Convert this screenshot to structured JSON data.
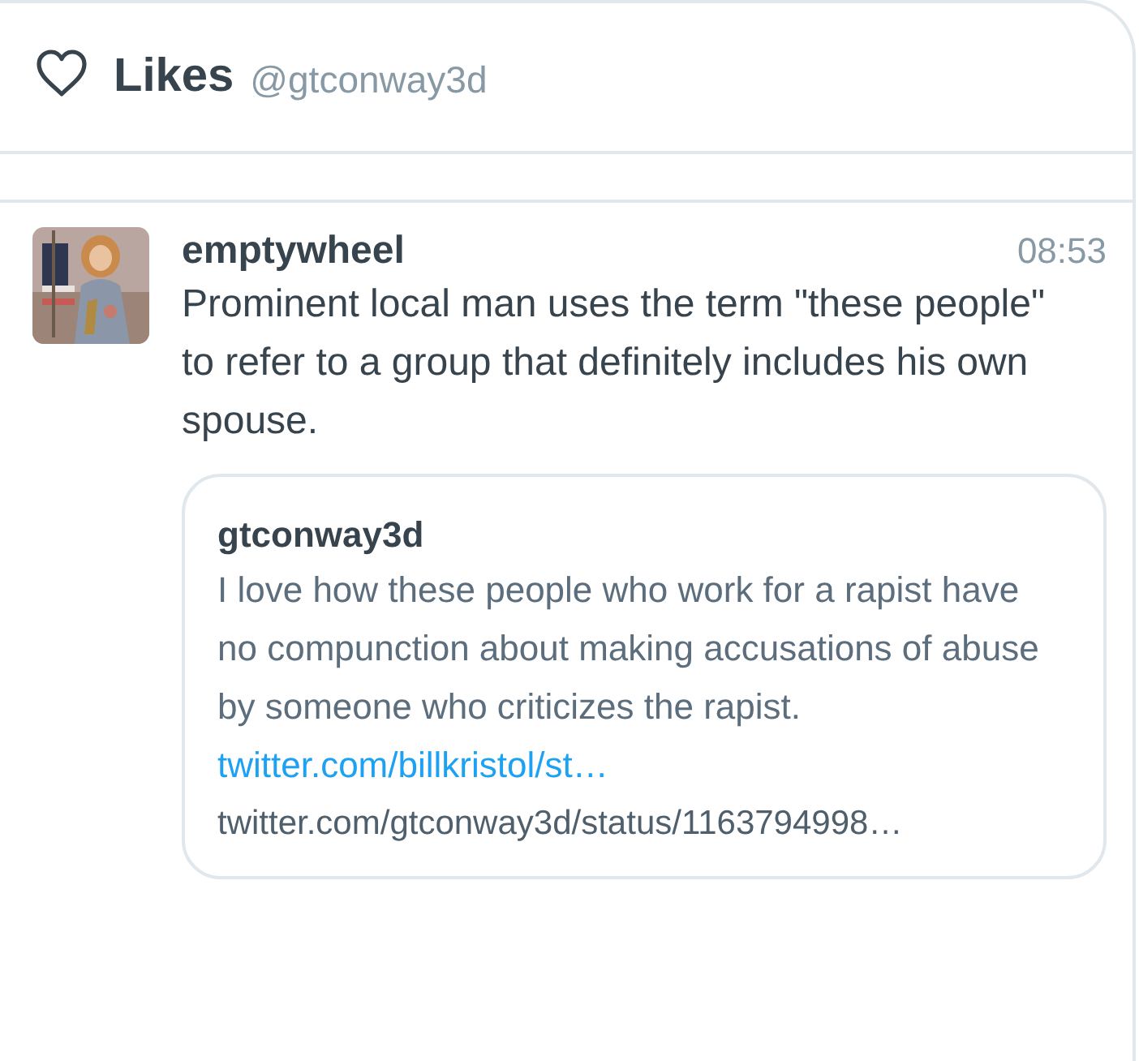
{
  "header": {
    "title": "Likes",
    "handle": "@gtconway3d"
  },
  "tweet": {
    "author": "emptywheel",
    "time": "08:53",
    "text": "Prominent local man uses the term \"these people\" to refer to a group that definitely includes his own spouse.",
    "quote": {
      "author": "gtconway3d",
      "text": "I love how these people who work for a rapist have no compunction about making accusations of abuse by someone who criticizes the rapist.",
      "link": "twitter.com/billkristol/st…",
      "url": "twitter.com/gtconway3d/status/1163794998…"
    }
  }
}
